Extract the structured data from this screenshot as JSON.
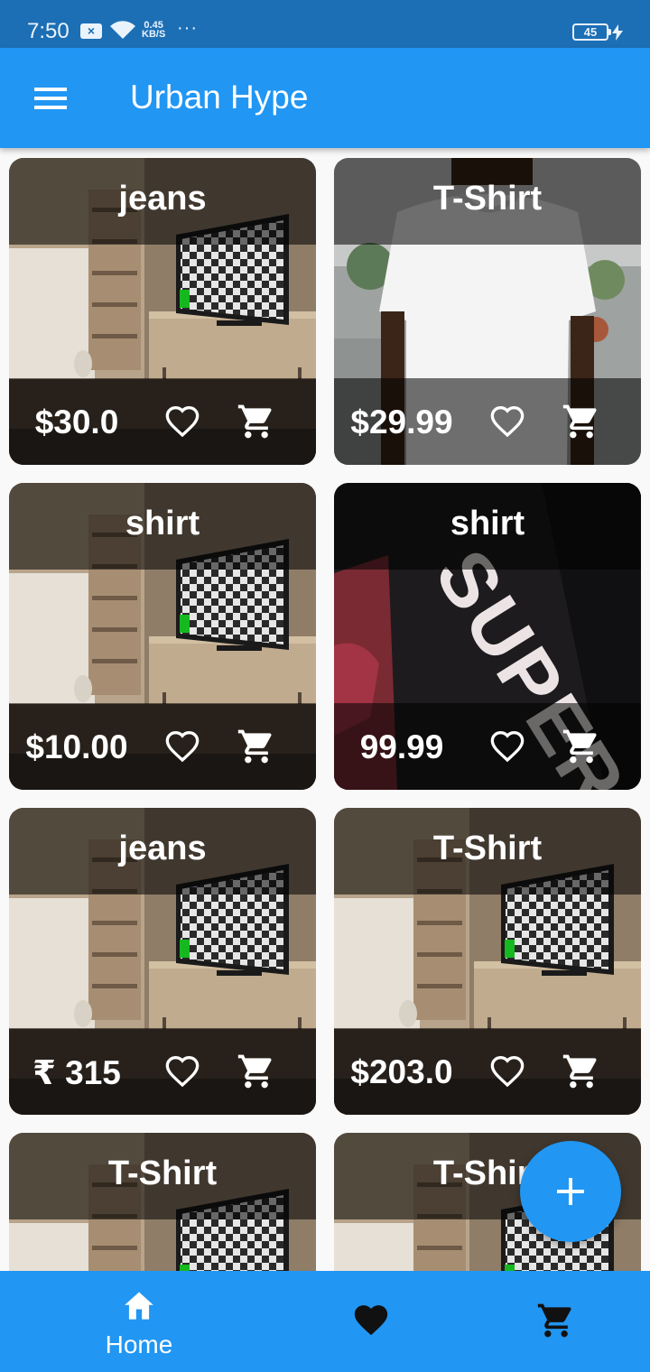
{
  "status_bar": {
    "time": "7:50",
    "notification_badge": "×",
    "net_speed_value": "0.45",
    "net_speed_unit": "KB/S",
    "more": "···",
    "battery": "45"
  },
  "app_bar": {
    "title": "Urban Hype"
  },
  "products": [
    {
      "title": "jeans",
      "price": "$30.0",
      "image": "room-tv"
    },
    {
      "title": "T-Shirt",
      "price": "$29.99",
      "image": "white-tshirt"
    },
    {
      "title": "shirt",
      "price": "$10.00",
      "image": "room-tv"
    },
    {
      "title": "shirt",
      "price": "99.99",
      "image": "black-sweatshirt"
    },
    {
      "title": "jeans",
      "price": "₹ 315",
      "image": "room-tv"
    },
    {
      "title": "T-Shirt",
      "price": "$203.0",
      "image": "room-tv"
    },
    {
      "title": "T-Shirt",
      "price": "",
      "image": "room-tv"
    },
    {
      "title": "T-Shirt",
      "price": "",
      "image": "room-tv"
    }
  ],
  "bottom_nav": {
    "home_label": "Home",
    "items": [
      "home-icon",
      "heart-icon",
      "cart-icon"
    ]
  },
  "colors": {
    "primary": "#2196f3",
    "status_bar": "#1c6fb5",
    "overlay": "rgba(0,0,0,0.55)",
    "text_on_primary": "#ffffff"
  }
}
